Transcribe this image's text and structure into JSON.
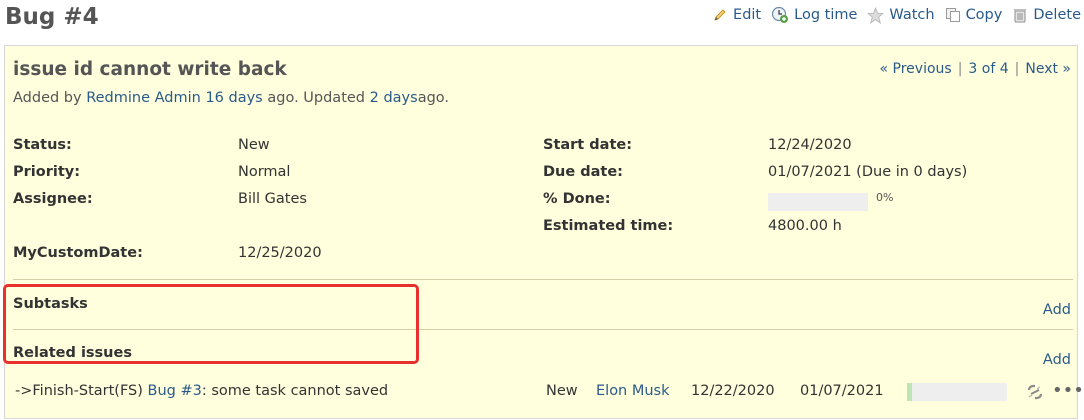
{
  "header": {
    "title": "Bug #4",
    "actions": {
      "edit": "Edit",
      "log_time": "Log time",
      "watch": "Watch",
      "copy": "Copy",
      "delete": "Delete"
    }
  },
  "issue": {
    "subject": "issue id cannot write back",
    "nav": {
      "previous": "« Previous",
      "position": "3 of 4",
      "next": "Next »",
      "sep": "|"
    },
    "author": {
      "added_by": "Added by",
      "author_name": "Redmine Admin",
      "created_ago": "16 days",
      "mid": "ago. Updated",
      "updated_ago": "2 days",
      "end": "ago."
    },
    "attributes": {
      "status": {
        "label": "Status:",
        "value": "New"
      },
      "priority": {
        "label": "Priority:",
        "value": "Normal"
      },
      "assignee": {
        "label": "Assignee:",
        "value": "Bill Gates"
      },
      "custom_date": {
        "label": "MyCustomDate:",
        "value": "12/25/2020"
      },
      "start_date": {
        "label": "Start date:",
        "value": "12/24/2020"
      },
      "due_date": {
        "label": "Due date:",
        "value": "01/07/2021 (Due in 0 days)"
      },
      "done": {
        "label": "% Done:",
        "value": "0%",
        "progress": 0
      },
      "estimated": {
        "label": "Estimated time:",
        "value": "4800.00 h"
      }
    },
    "subtasks": {
      "title": "Subtasks",
      "add": "Add"
    },
    "related": {
      "title": "Related issues",
      "add": "Add",
      "rows": [
        {
          "relation": "->Finish-Start(FS)",
          "issue_link": "Bug #3",
          "subject": ": some task cannot saved",
          "status": "New",
          "assignee": "Elon Musk",
          "start": "12/22/2020",
          "due": "01/07/2021",
          "progress": 0
        }
      ]
    }
  },
  "colors": {
    "issue_bg": "#ffffdd",
    "link": "#2a5a8a",
    "highlight": "#e8312f"
  }
}
